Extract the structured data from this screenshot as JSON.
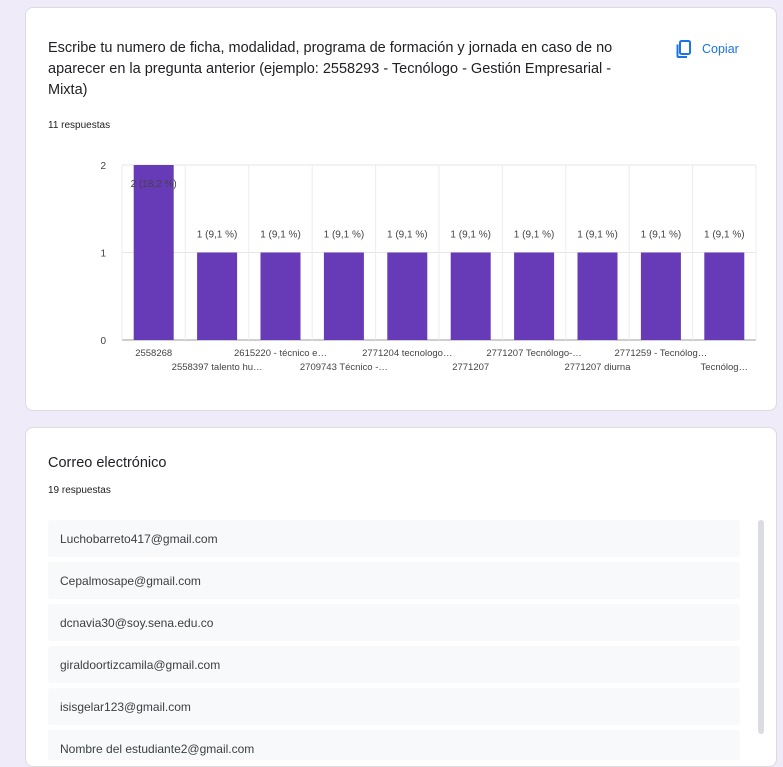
{
  "question1": {
    "title": "Escribe tu numero de ficha, modalidad, programa de formación y jornada en caso de no aparecer en la pregunta anterior (ejemplo: 2558293 - Tecnólogo - Gestión Empresarial - Mixta)",
    "copy_label": "Copiar",
    "response_count": "11 respuestas"
  },
  "chart_data": {
    "type": "bar",
    "categories": [
      "2558268",
      "2558397 talento hu…",
      "2615220 - técnico e…",
      "2709743 Técnico -…",
      "2771204 tecnologo…",
      "2771207",
      "2771207 Tecnólogo-…",
      "2771207 diurna",
      "2771259 - Tecnólog…",
      "Tecnólog…"
    ],
    "values": [
      2,
      1,
      1,
      1,
      1,
      1,
      1,
      1,
      1,
      1
    ],
    "data_labels": [
      "2 (18,2 %)",
      "1 (9,1 %)",
      "1 (9,1 %)",
      "1 (9,1 %)",
      "1 (9,1 %)",
      "1 (9,1 %)",
      "1 (9,1 %)",
      "1 (9,1 %)",
      "1 (9,1 %)",
      "1 (9,1 %)"
    ],
    "y_ticks": [
      "0",
      "1",
      "2"
    ],
    "ylim": [
      0,
      2
    ],
    "bar_color": "#673ab7",
    "grid": true
  },
  "question2": {
    "title": "Correo electrónico",
    "response_count": "19 respuestas",
    "responses": [
      "Luchobarreto417@gmail.com",
      "Cepalmosape@gmail.com",
      "dcnavia30@soy.sena.edu.co",
      "giraldoortizcamila@gmail.com",
      "isisgelar123@gmail.com",
      "Nombre del estudiante2@gmail.com"
    ]
  },
  "colors": {
    "accent": "#1a73e8",
    "page_bg": "#f0ebf8"
  },
  "icons": {
    "copy": "copy-icon"
  }
}
